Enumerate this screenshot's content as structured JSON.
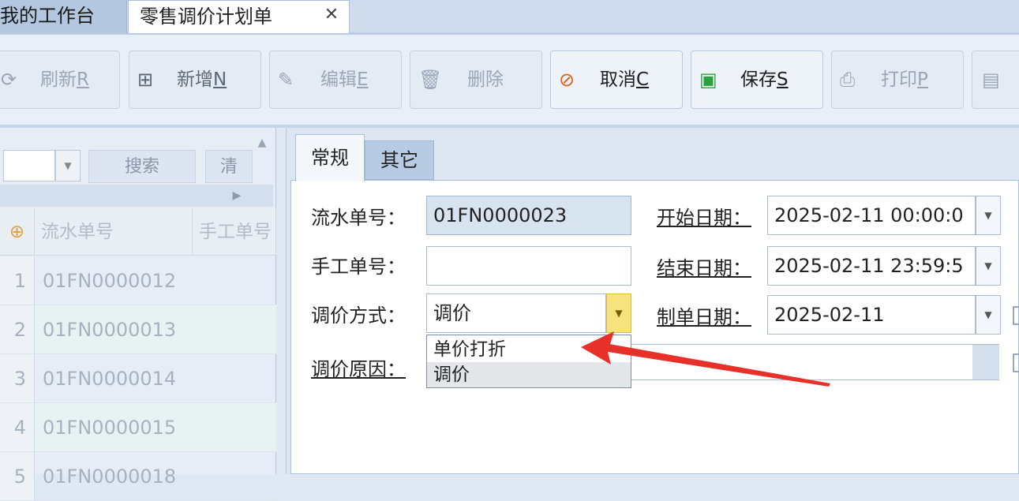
{
  "tabs": [
    {
      "label": "我的工作台"
    },
    {
      "label": "零售调价计划单",
      "close": "✕"
    }
  ],
  "toolbar": {
    "refresh": {
      "label": "刷新",
      "key": "R"
    },
    "add": {
      "label": "新增",
      "key": "N"
    },
    "edit": {
      "label": "编辑",
      "key": "E"
    },
    "delete": {
      "label": "删除"
    },
    "cancel": {
      "label": "取消",
      "key": "C"
    },
    "save": {
      "label": "保存",
      "key": "S"
    },
    "print": {
      "label": "打印",
      "key": "P"
    }
  },
  "left_panel": {
    "search_label": "搜索",
    "clipped_button": "清",
    "columns": [
      "流水单号",
      "手工单号"
    ],
    "rows": [
      {
        "num": "1",
        "serial": "01FN0000012"
      },
      {
        "num": "2",
        "serial": "01FN0000013"
      },
      {
        "num": "3",
        "serial": "01FN0000014"
      },
      {
        "num": "4",
        "serial": "01FN0000015"
      },
      {
        "num": "5",
        "serial": "01FN0000018"
      }
    ]
  },
  "form_tabs": [
    "常规",
    "其它"
  ],
  "form": {
    "serial_label": "流水单号：",
    "serial_value": "01FN0000023",
    "manual_label": "手工单号：",
    "manual_value": "",
    "method_label": "调价方式：",
    "method_value": "调价",
    "reason_label": "调价原因：",
    "start_label": "开始日期：",
    "start_value": "2025-02-11 00:00:0",
    "end_label": "结束日期：",
    "end_value": "2025-02-11 23:59:5",
    "created_label": "制单日期：",
    "created_value": "2025-02-11",
    "method_options": [
      "单价打折",
      "调价"
    ],
    "method_selected_index": 1
  },
  "colors": {
    "annotation_arrow": "#e8302a",
    "cancel_icon": "#e0601a",
    "save_icon": "#2aa13a"
  }
}
